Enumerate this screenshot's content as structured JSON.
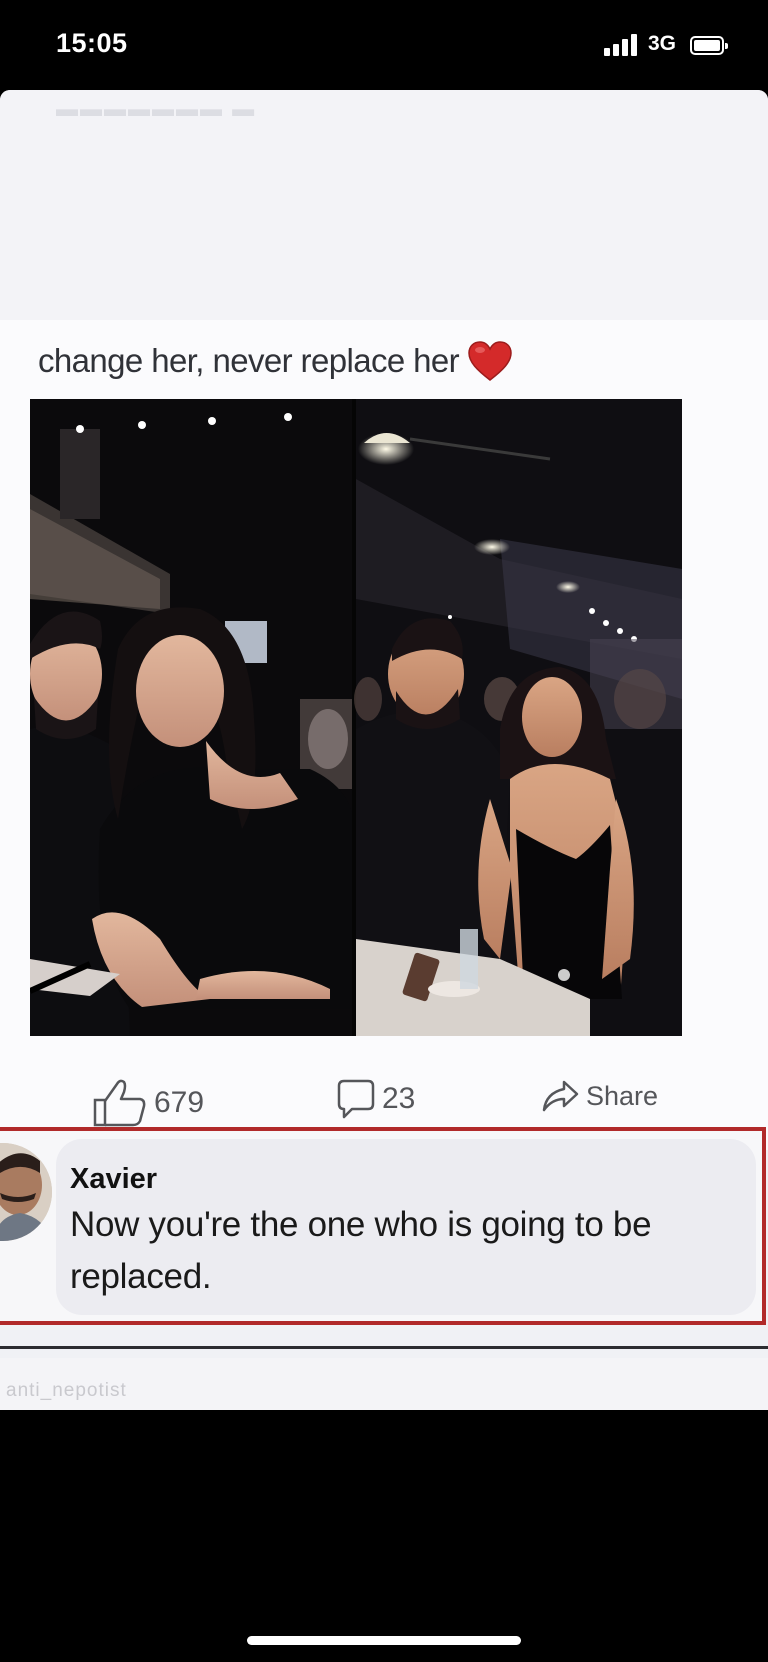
{
  "status_bar": {
    "time": "15:05",
    "network": "3G",
    "icons": [
      "signal-bars-icon",
      "battery-icon"
    ]
  },
  "post": {
    "caption": "change her, never replace her",
    "caption_emoji": "heart-icon",
    "image_alt": "side-by-side photos of a couple",
    "likes": "679",
    "comments": "23",
    "share_label": "Share"
  },
  "comment": {
    "author": "Xavier",
    "text": "Now you're the one who is going to be replaced."
  },
  "watermark": "anti_nepotist",
  "colors": {
    "highlight_border": "#b12a2a",
    "heart": "#d42a2a",
    "comment_bubble": "#ececf1"
  }
}
